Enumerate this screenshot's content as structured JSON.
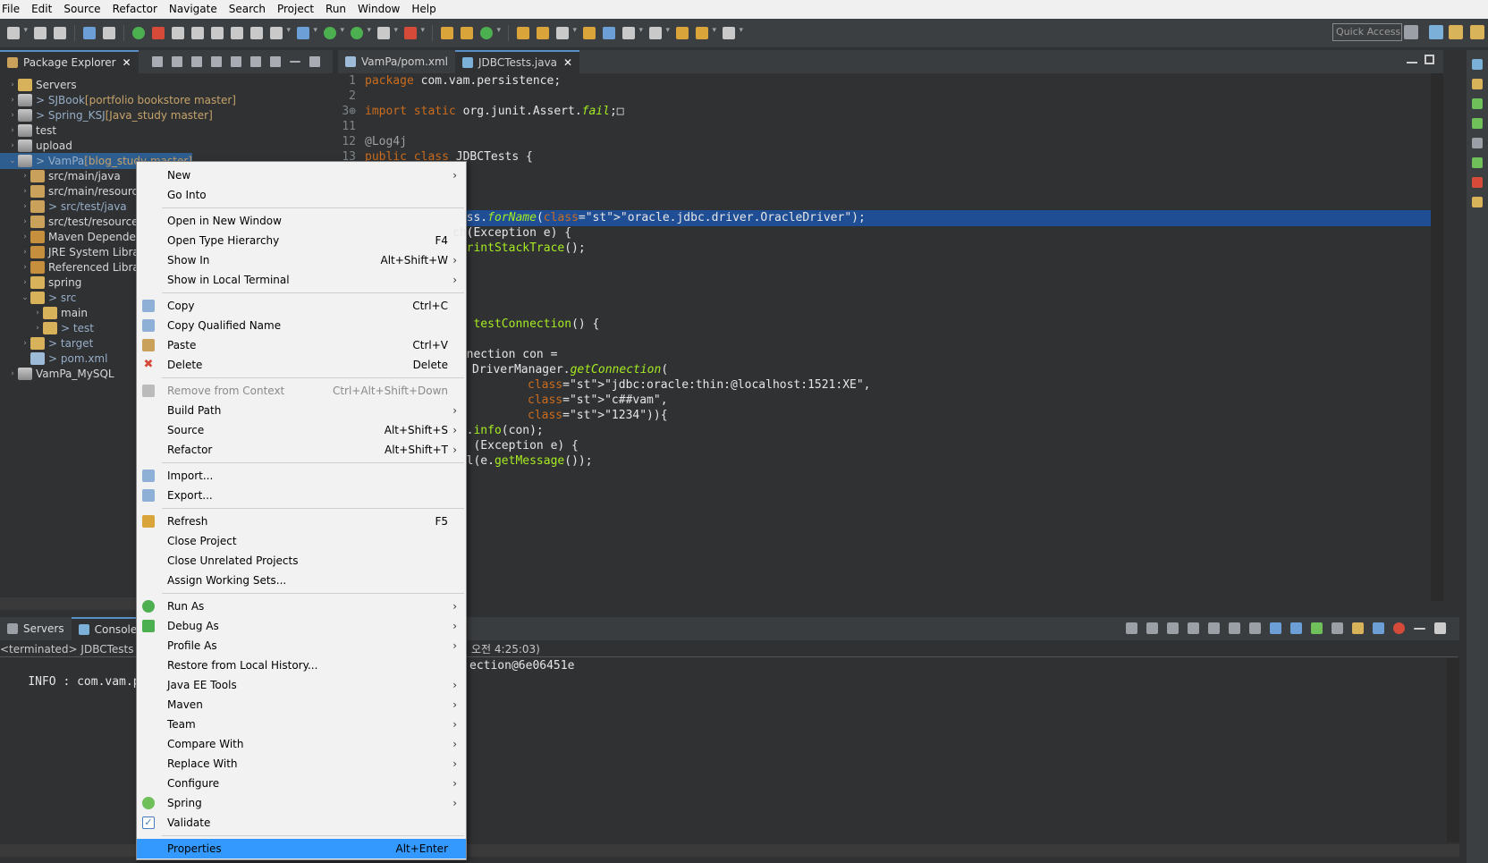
{
  "menubar": {
    "items": [
      "File",
      "Edit",
      "Source",
      "Refactor",
      "Navigate",
      "Search",
      "Project",
      "Run",
      "Window",
      "Help"
    ]
  },
  "toolbar": {
    "quick_access_placeholder": "Quick Access"
  },
  "package_explorer": {
    "tab_label": "Package Explorer",
    "tree": [
      {
        "label": "Servers",
        "decoration": "",
        "icon": "folder-icon"
      },
      {
        "label": "> SJBook",
        "decoration": " [portfolio bookstore master]",
        "icon": "project-icon"
      },
      {
        "label": "> Spring_KSJ",
        "decoration": " [Java_study master]",
        "icon": "project-icon"
      },
      {
        "label": "test",
        "decoration": "",
        "icon": "project-icon"
      },
      {
        "label": "upload",
        "decoration": "",
        "icon": "project-icon"
      },
      {
        "label": "> VamPa",
        "decoration": " [blog_study master]",
        "icon": "project-icon"
      },
      {
        "label": "src/main/java",
        "decoration": "",
        "icon": "source-folder-icon"
      },
      {
        "label": "src/main/resource",
        "decoration": "",
        "icon": "source-folder-icon"
      },
      {
        "label": "> src/test/java",
        "decoration": "",
        "icon": "source-folder-icon"
      },
      {
        "label": "src/test/resources",
        "decoration": "",
        "icon": "source-folder-icon"
      },
      {
        "label": "Maven Dependenc",
        "decoration": "",
        "icon": "library-icon"
      },
      {
        "label": "JRE System Library",
        "decoration": "",
        "icon": "library-icon"
      },
      {
        "label": "Referenced Librarie",
        "decoration": "",
        "icon": "library-icon"
      },
      {
        "label": "spring",
        "decoration": "",
        "icon": "folder-icon"
      },
      {
        "label": "> src",
        "decoration": "",
        "icon": "folder-icon"
      },
      {
        "label": "main",
        "decoration": "",
        "icon": "folder-icon"
      },
      {
        "label": "> test",
        "decoration": "",
        "icon": "folder-icon"
      },
      {
        "label": "> target",
        "decoration": "",
        "icon": "folder-icon"
      },
      {
        "label": "> pom.xml",
        "decoration": "",
        "icon": "xml-file-icon"
      },
      {
        "label": "VamPa_MySQL",
        "decoration": "",
        "icon": "project-icon"
      }
    ]
  },
  "editor": {
    "tabs": [
      {
        "label": "VamPa/pom.xml",
        "active": false
      },
      {
        "label": "JDBCTests.java",
        "active": true
      }
    ],
    "lines": [
      {
        "num": "1",
        "text": "package com.vam.persistence;"
      },
      {
        "num": "2",
        "text": ""
      },
      {
        "num": "3⊕",
        "text": "import static org.junit.Assert.fail;□"
      },
      {
        "num": "11",
        "text": ""
      },
      {
        "num": "12",
        "text": "@Log4j"
      },
      {
        "num": "13",
        "text": "public class JDBCTests {"
      },
      {
        "num": "",
        "text": "lass.forName(\"oracle.jdbc.driver.OracleDriver\");"
      },
      {
        "num": "",
        "text": "ch(Exception e) {"
      },
      {
        "num": "",
        "text": ".printStackTrace();"
      },
      {
        "num": "",
        "text": "id testConnection() {"
      },
      {
        "num": "",
        "text": "onnection con ="
      },
      {
        "num": "",
        "text": "DriverManager.getConnection("
      },
      {
        "num": "",
        "text": "\"jdbc:oracle:thin:@localhost:1521:XE\","
      },
      {
        "num": "",
        "text": "\"c##vam\","
      },
      {
        "num": "",
        "text": "\"1234\")){"
      },
      {
        "num": "",
        "text": "og.info(con);"
      },
      {
        "num": "",
        "text": "ch (Exception e) {"
      },
      {
        "num": "",
        "text": "ail(e.getMessage());"
      }
    ]
  },
  "console": {
    "tabs": [
      "Servers",
      "Console"
    ],
    "status_left": "<terminated> JDBCTests [JU",
    "status_right": "오전 4:25:03)",
    "output_left": "INFO : com.vam.pers",
    "output_right": "ection@6e06451e"
  },
  "context_menu": {
    "items": [
      {
        "label": "New",
        "accel": "",
        "submenu": true,
        "icon": ""
      },
      {
        "label": "Go Into",
        "accel": "",
        "submenu": false,
        "icon": ""
      },
      {
        "sep": true
      },
      {
        "label": "Open in New Window",
        "accel": "",
        "submenu": false,
        "icon": ""
      },
      {
        "label": "Open Type Hierarchy",
        "accel": "F4",
        "submenu": false,
        "icon": ""
      },
      {
        "label": "Show In",
        "accel": "Alt+Shift+W",
        "submenu": true,
        "icon": ""
      },
      {
        "label": "Show in Local Terminal",
        "accel": "",
        "submenu": true,
        "icon": ""
      },
      {
        "sep": true
      },
      {
        "label": "Copy",
        "accel": "Ctrl+C",
        "submenu": false,
        "icon": "copy-icon"
      },
      {
        "label": "Copy Qualified Name",
        "accel": "",
        "submenu": false,
        "icon": "copy-qualified-name-icon"
      },
      {
        "label": "Paste",
        "accel": "Ctrl+V",
        "submenu": false,
        "icon": "paste-icon"
      },
      {
        "label": "Delete",
        "accel": "Delete",
        "submenu": false,
        "icon": "delete-icon"
      },
      {
        "sep": true
      },
      {
        "label": "Remove from Context",
        "accel": "Ctrl+Alt+Shift+Down",
        "submenu": false,
        "icon": "remove-context-icon",
        "disabled": true
      },
      {
        "label": "Build Path",
        "accel": "",
        "submenu": true,
        "icon": ""
      },
      {
        "label": "Source",
        "accel": "Alt+Shift+S",
        "submenu": true,
        "icon": ""
      },
      {
        "label": "Refactor",
        "accel": "Alt+Shift+T",
        "submenu": true,
        "icon": ""
      },
      {
        "sep": true
      },
      {
        "label": "Import...",
        "accel": "",
        "submenu": false,
        "icon": "import-icon"
      },
      {
        "label": "Export...",
        "accel": "",
        "submenu": false,
        "icon": "export-icon"
      },
      {
        "sep": true
      },
      {
        "label": "Refresh",
        "accel": "F5",
        "submenu": false,
        "icon": "refresh-icon"
      },
      {
        "label": "Close Project",
        "accel": "",
        "submenu": false,
        "icon": ""
      },
      {
        "label": "Close Unrelated Projects",
        "accel": "",
        "submenu": false,
        "icon": ""
      },
      {
        "label": "Assign Working Sets...",
        "accel": "",
        "submenu": false,
        "icon": ""
      },
      {
        "sep": true
      },
      {
        "label": "Run As",
        "accel": "",
        "submenu": true,
        "icon": "run-icon"
      },
      {
        "label": "Debug As",
        "accel": "",
        "submenu": true,
        "icon": "debug-icon"
      },
      {
        "label": "Profile As",
        "accel": "",
        "submenu": true,
        "icon": ""
      },
      {
        "label": "Restore from Local History...",
        "accel": "",
        "submenu": false,
        "icon": ""
      },
      {
        "label": "Java EE Tools",
        "accel": "",
        "submenu": true,
        "icon": ""
      },
      {
        "label": "Maven",
        "accel": "",
        "submenu": true,
        "icon": ""
      },
      {
        "label": "Team",
        "accel": "",
        "submenu": true,
        "icon": ""
      },
      {
        "label": "Compare With",
        "accel": "",
        "submenu": true,
        "icon": ""
      },
      {
        "label": "Replace With",
        "accel": "",
        "submenu": true,
        "icon": ""
      },
      {
        "label": "Configure",
        "accel": "",
        "submenu": true,
        "icon": ""
      },
      {
        "label": "Spring",
        "accel": "",
        "submenu": true,
        "icon": "spring-icon"
      },
      {
        "label": "Validate",
        "accel": "",
        "submenu": false,
        "icon": "checkbox-checked-icon"
      },
      {
        "sep": true
      },
      {
        "label": "Properties",
        "accel": "Alt+Enter",
        "submenu": false,
        "icon": "",
        "active": true
      }
    ]
  },
  "colors": {
    "background": "#2f3133",
    "selection": "#1f4e94",
    "menu_highlight": "#3399ff"
  }
}
